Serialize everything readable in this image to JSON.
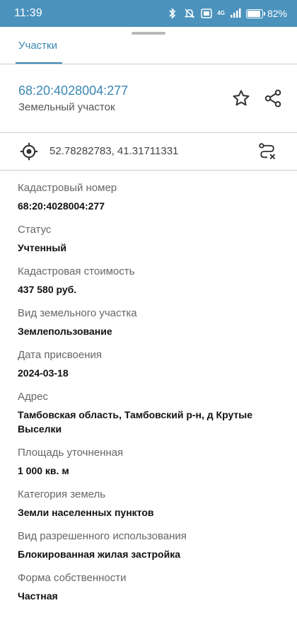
{
  "status_bar": {
    "time": "11:39",
    "network": "4G",
    "battery_percent": "82%",
    "battery_level": 0.82,
    "icons": [
      "bluetooth-icon",
      "mute-icon",
      "volte-icon",
      "signal-icon",
      "battery-icon"
    ]
  },
  "tabs": [
    {
      "label": "Участки",
      "active": true
    }
  ],
  "parcel": {
    "cadastral_number": "68:20:4028004:277",
    "type": "Земельный участок"
  },
  "actions": [
    "star-icon",
    "share-icon"
  ],
  "coordinates": {
    "text": "52.78282783, 41.31711331"
  },
  "properties": [
    {
      "label": "Кадастровый номер",
      "value": "68:20:4028004:277"
    },
    {
      "label": "Статус",
      "value": "Учтенный"
    },
    {
      "label": "Кадастровая стоимость",
      "value": "437 580 руб."
    },
    {
      "label": "Вид земельного участка",
      "value": "Землепользование"
    },
    {
      "label": "Дата присвоения",
      "value": "2024-03-18"
    },
    {
      "label": "Адрес",
      "value": "Тамбовская область, Тамбовский р-н, д Крутые Выселки"
    },
    {
      "label": "Площадь уточненная",
      "value": "1 000 кв. м"
    },
    {
      "label": "Категория земель",
      "value": "Земли населенных пунктов"
    },
    {
      "label": "Вид разрешенного использования",
      "value": "Блокированная жилая застройка"
    },
    {
      "label": "Форма собственности",
      "value": "Частная"
    }
  ],
  "colors": {
    "status_bar": "#4b93bd",
    "accent": "#3a87b3"
  }
}
